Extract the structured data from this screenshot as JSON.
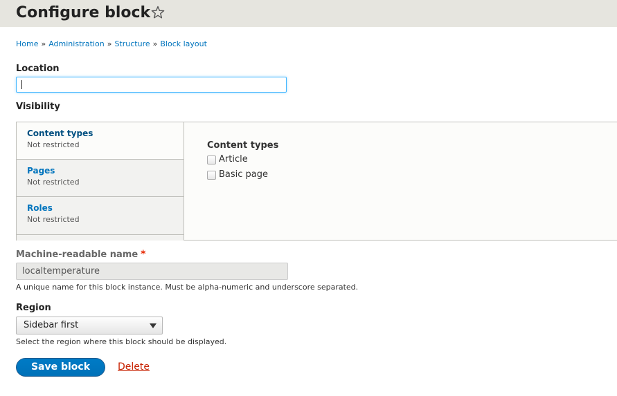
{
  "header": {
    "title": "Configure block",
    "shortcut_icon": "star-outline-icon"
  },
  "breadcrumb": {
    "items": [
      "Home",
      "Administration",
      "Structure",
      "Block layout"
    ],
    "separator": "»"
  },
  "location": {
    "label": "Location",
    "value": ""
  },
  "visibility": {
    "label": "Visibility",
    "tabs": [
      {
        "title": "Content types",
        "summary": "Not restricted",
        "selected": true
      },
      {
        "title": "Pages",
        "summary": "Not restricted",
        "selected": false
      },
      {
        "title": "Roles",
        "summary": "Not restricted",
        "selected": false
      }
    ],
    "pane": {
      "title": "Content types",
      "options": [
        {
          "label": "Article",
          "checked": false
        },
        {
          "label": "Basic page",
          "checked": false
        }
      ]
    }
  },
  "machine_name": {
    "label": "Machine-readable name",
    "required_marker": "*",
    "value": "localtemperature",
    "description": "A unique name for this block instance. Must be alpha-numeric and underscore separated."
  },
  "region": {
    "label": "Region",
    "selected": "Sidebar first",
    "description": "Select the region where this block should be displayed."
  },
  "actions": {
    "save_label": "Save block",
    "delete_label": "Delete"
  },
  "colors": {
    "link": "#0074bd",
    "primary_button": "#0074bd",
    "danger_link": "#c72100",
    "focus_border": "#40b6ff"
  }
}
